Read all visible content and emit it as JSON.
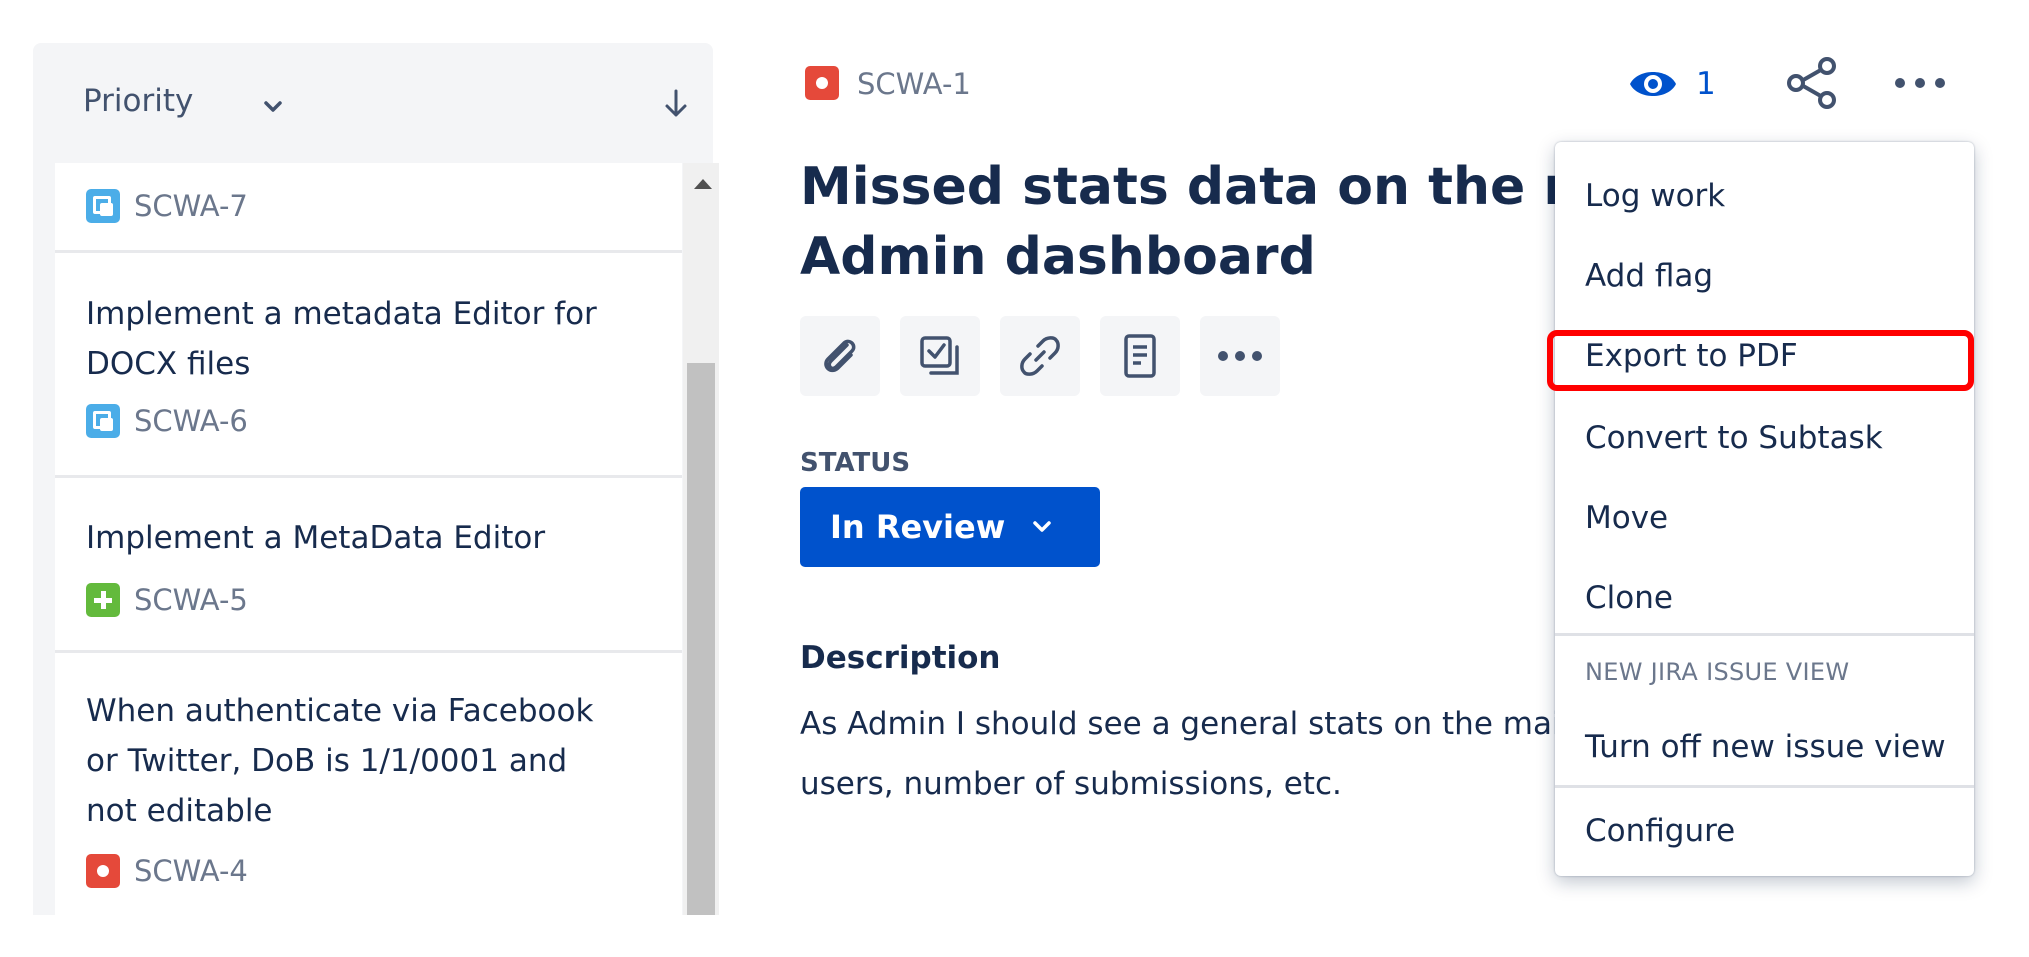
{
  "sidebar": {
    "sort": {
      "label": "Priority"
    },
    "issues": [
      {
        "summary_lines": [],
        "key": "SCWA-7",
        "type": "subtask"
      },
      {
        "summary_lines": [
          "Implement a metadata Editor for",
          "DOCX files"
        ],
        "key": "SCWA-6",
        "type": "subtask"
      },
      {
        "summary_lines": [
          "Implement a MetaData Editor"
        ],
        "key": "SCWA-5",
        "type": "story"
      },
      {
        "summary_lines": [
          "When authenticate via Facebook",
          "or Twitter, DoB is 1/1/0001 and",
          "not editable"
        ],
        "key": "SCWA-4",
        "type": "bug"
      }
    ]
  },
  "issue": {
    "key": "SCWA-1",
    "type": "bug",
    "watchers": "1",
    "title_lines": [
      "Missed stats data on the main",
      "Admin dashboard"
    ],
    "status_label": "STATUS",
    "status": "In Review",
    "description_heading": "Description",
    "description_lines": [
      "As Admin I should see a general stats on the main",
      "users, number of submissions, etc."
    ]
  },
  "quick_actions": [
    "paperclip-icon",
    "checklist-icon",
    "link-icon",
    "page-icon",
    "more-icon"
  ],
  "menu": {
    "items": [
      "Log work",
      "Add flag",
      "Export to PDF",
      "Convert to Subtask",
      "Move",
      "Clone"
    ],
    "group_heading": "NEW JIRA ISSUE VIEW",
    "group_item": "Turn off new issue view",
    "configure": "Configure",
    "highlighted": "Export to PDF"
  },
  "colors": {
    "primary": "#0052cc",
    "highlight": "#ff0000",
    "bug": "#e5493a",
    "subtask": "#4bade8",
    "story": "#63ba3c"
  }
}
